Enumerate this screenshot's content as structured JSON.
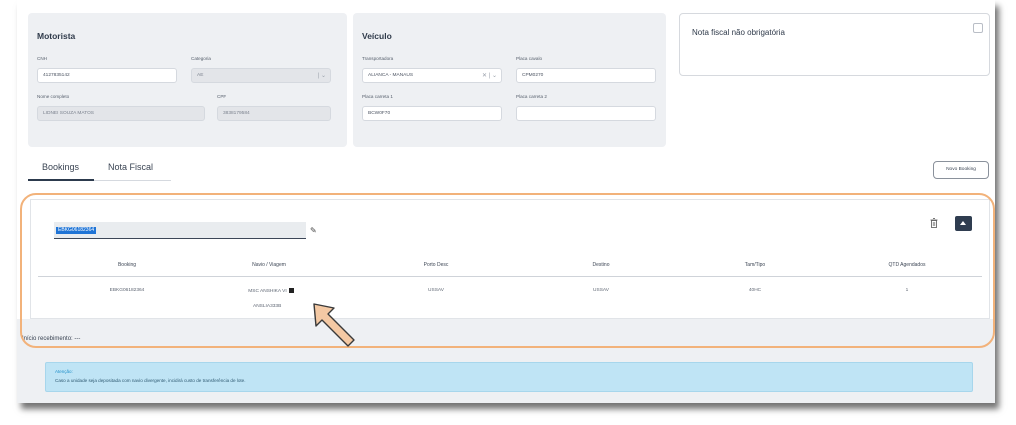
{
  "motorista": {
    "title": "Motorista",
    "cnh_label": "CNH",
    "cnh_value": "4127835142",
    "categoria_label": "Categoria",
    "categoria_value": "AE",
    "nome_label": "Nome completo",
    "nome_value": "LIDNEI SOUZA MATOS",
    "cpf_label": "CPF",
    "cpf_value": "3838179584"
  },
  "veiculo": {
    "title": "Veículo",
    "transportadora_label": "Transportadora",
    "transportadora_value": "ALIANCA - MANAUS",
    "placa_cavalo_label": "Placa cavalo",
    "placa_cavalo_value": "CPM0270",
    "placa_carreta1_label": "Placa carreta 1",
    "placa_carreta1_value": "BCW0F70",
    "placa_carreta2_label": "Placa carreta 2",
    "placa_carreta2_value": ""
  },
  "nota_fiscal": {
    "label": "Nota fiscal não obrigatória"
  },
  "tabs": [
    {
      "label": "Bookings",
      "active": true
    },
    {
      "label": "Nota Fiscal",
      "active": false
    }
  ],
  "novo_booking_label": "Novo Booking",
  "booking": {
    "code": "EBKG06182364",
    "headers": [
      "Booking",
      "Navio / Viagem",
      "Porto Desc",
      "Destino",
      "Tam/Tipo",
      "QTD Agendados"
    ],
    "row": {
      "booking": "EBKG06182364",
      "navio": "MSC ANSHIKA VI",
      "viagem": "ANSLIA333B",
      "porto_desc": "USSAV",
      "destino": "USSAV",
      "tam_tipo": "40HC",
      "qtd": "1"
    }
  },
  "inicio_recebimento": "Início recebimento: ---",
  "alert": {
    "title": "Atenção:",
    "text": "Caso a unidade seja depositada com navio divergente, incidirá custo de transferência de lote."
  },
  "colors": {
    "highlight_border": "#f2b27a",
    "card_bg": "#eef0f3",
    "alert_bg": "#bfe4f5",
    "dark_button": "#2f3d50",
    "selection": "#1f74d6"
  }
}
